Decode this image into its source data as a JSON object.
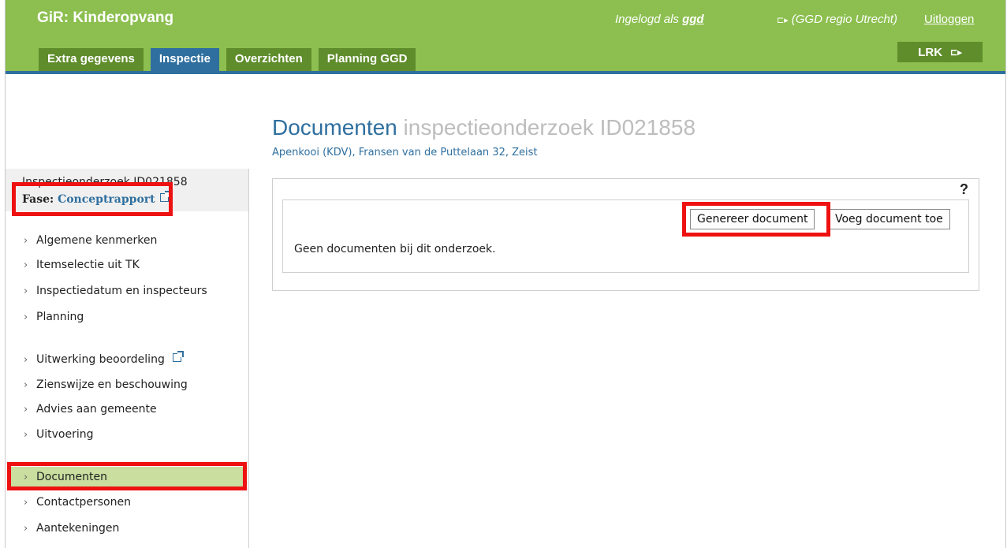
{
  "header": {
    "app_title": "GiR: Kinderopvang",
    "logged_in_prefix": "Ingelogd als ",
    "logged_in_user": "ggd",
    "region": "(GGD regio Utrecht)",
    "logout": "Uitloggen",
    "exit_icon": "sign-out-icon",
    "lrk_label": "LRK",
    "tabs": [
      {
        "label": "Extra gegevens",
        "active": false
      },
      {
        "label": "Inspectie",
        "active": true
      },
      {
        "label": "Overzichten",
        "active": false
      },
      {
        "label": "Planning GGD",
        "active": false
      }
    ]
  },
  "page": {
    "title": "Documenten",
    "title_sub": "inspectieonderzoek ID021858",
    "subtitle": "Apenkooi (KDV), Fransen van de Puttelaan 32, Zeist"
  },
  "sidebar": {
    "case_id": "Inspectieonderzoek ID021858",
    "phase_label": "Fase:",
    "phase_value": "Conceptrapport",
    "items": [
      {
        "label": "Algemene kenmerken"
      },
      {
        "label": "Itemselectie uit TK"
      },
      {
        "label": "Inspectiedatum en inspecteurs"
      },
      {
        "label": "Planning"
      },
      {
        "label": "Uitwerking beoordeling"
      },
      {
        "label": "Zienswijze en beschouwing"
      },
      {
        "label": "Advies aan gemeente"
      },
      {
        "label": "Uitvoering"
      },
      {
        "label": "Documenten"
      },
      {
        "label": "Contactpersonen"
      },
      {
        "label": "Aantekeningen"
      }
    ],
    "active_item": "Documenten"
  },
  "main": {
    "help": "?",
    "generate_button": "Genereer document",
    "add_button": "Voeg document toe",
    "empty_message": "Geen documenten bij dit onderzoek."
  },
  "colors": {
    "header_green": "#8cbf4f",
    "tab_green": "#5f8d2c",
    "active_blue": "#2f6f9f",
    "highlight_red": "#ee1111",
    "nav_active": "#c9de9f"
  }
}
